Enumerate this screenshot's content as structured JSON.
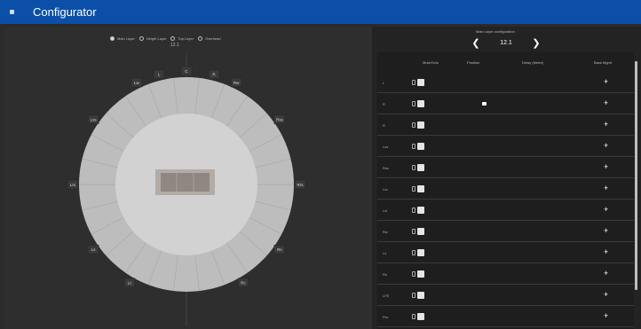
{
  "app": {
    "title": "Configurator"
  },
  "viewer": {
    "options": [
      {
        "label": "Main Layer",
        "selected": true
      },
      {
        "label": "Height Layer",
        "selected": false
      },
      {
        "label": "Top Layer",
        "selected": false
      },
      {
        "label": "Overhead",
        "selected": false
      }
    ],
    "subtitle": "12.1",
    "speakers": [
      "C",
      "L",
      "R",
      "Lw",
      "Rw",
      "Lss",
      "Rss",
      "Lrs",
      "Rrs",
      "Ls",
      "Rs",
      "Lc",
      "Rc"
    ]
  },
  "config": {
    "label": "Main Layer configuration",
    "prev": "❮",
    "value": "12.1",
    "next": "❯"
  },
  "table": {
    "columns": [
      "Mute/Solo",
      "Position",
      "Delay (Meter)",
      "Bass Mgmt"
    ],
    "rows": [
      {
        "label": "L",
        "plus": "+",
        "dot": false
      },
      {
        "label": "R",
        "plus": "+",
        "dot": true
      },
      {
        "label": "R",
        "plus": "+",
        "dot": false
      },
      {
        "label": "Lss",
        "plus": "+",
        "dot": false
      },
      {
        "label": "Rss",
        "plus": "+",
        "dot": false
      },
      {
        "label": "Lrs",
        "plus": "+",
        "dot": false
      },
      {
        "label": "Lw",
        "plus": "+",
        "dot": false
      },
      {
        "label": "Rw",
        "plus": "+",
        "dot": false
      },
      {
        "label": "Ls",
        "plus": "+",
        "dot": false
      },
      {
        "label": "Rs",
        "plus": "+",
        "dot": false
      },
      {
        "label": "LFE",
        "plus": "+",
        "dot": false
      },
      {
        "label": "Rrs",
        "plus": "+",
        "dot": false
      }
    ]
  }
}
